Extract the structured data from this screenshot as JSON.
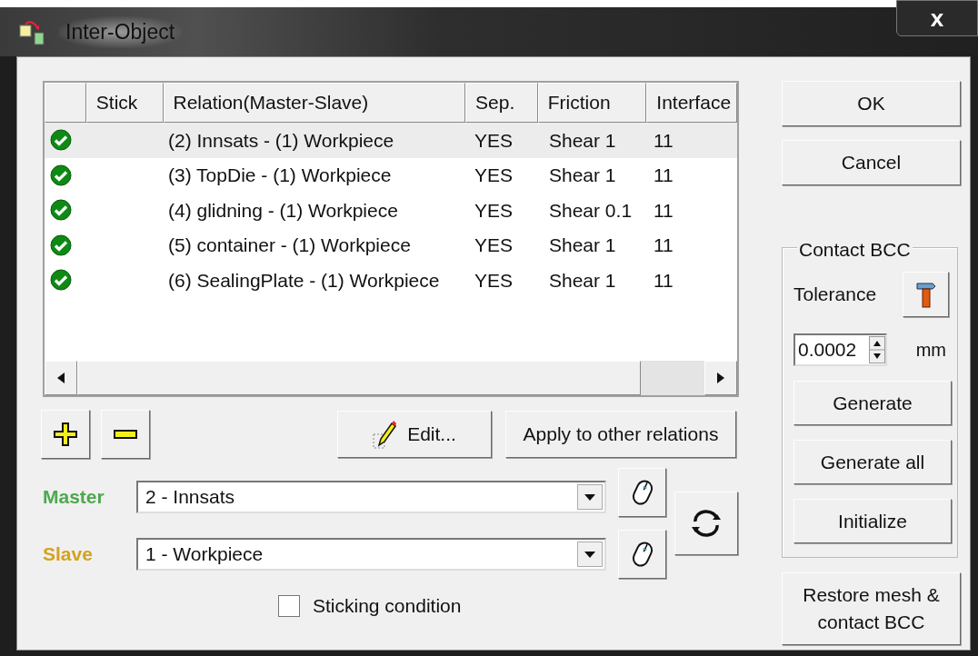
{
  "window": {
    "title": "Inter-Object",
    "close": "x"
  },
  "table": {
    "columns": [
      "Stick",
      "Relation(Master-Slave)",
      "Sep.",
      "Friction",
      "Interface"
    ],
    "rows": [
      {
        "relation": "(2) Innsats - (1) Workpiece",
        "sep": "YES",
        "friction": "Shear 1",
        "interface": "11",
        "status_ok": true,
        "selected": true
      },
      {
        "relation": "(3) TopDie - (1) Workpiece",
        "sep": "YES",
        "friction": "Shear 1",
        "interface": "11",
        "status_ok": true,
        "selected": false
      },
      {
        "relation": "(4) glidning - (1) Workpiece",
        "sep": "YES",
        "friction": "Shear 0.1",
        "interface": "11",
        "status_ok": true,
        "selected": false
      },
      {
        "relation": "(5) container - (1) Workpiece",
        "sep": "YES",
        "friction": "Shear 1",
        "interface": "11",
        "status_ok": true,
        "selected": false
      },
      {
        "relation": "(6) SealingPlate - (1) Workpiece",
        "sep": "YES",
        "friction": "Shear 1",
        "interface": "11",
        "status_ok": true,
        "selected": false
      }
    ]
  },
  "edit_button": "Edit...",
  "apply_button": "Apply to other relations",
  "master": {
    "label": "Master",
    "value": "2 - Innsats"
  },
  "slave": {
    "label": "Slave",
    "value": "1 - Workpiece"
  },
  "sticking_condition": {
    "label": "Sticking condition",
    "checked": false
  },
  "ok_button": "OK",
  "cancel_button": "Cancel",
  "contact_bcc": {
    "title": "Contact BCC",
    "tolerance_label": "Tolerance",
    "tolerance_value": "0.0002",
    "unit": "mm",
    "buttons": [
      "Generate",
      "Generate all",
      "Initialize"
    ]
  },
  "restore_button": "Restore mesh & contact BCC"
}
